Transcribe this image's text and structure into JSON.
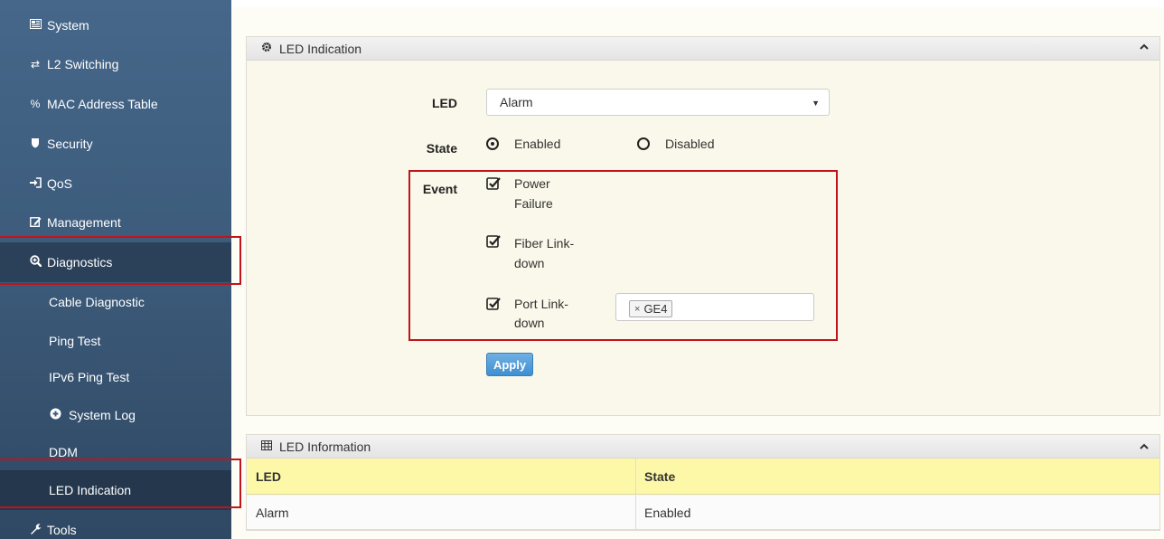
{
  "sidebar": {
    "items": [
      {
        "label": "System",
        "icon": "system-icon"
      },
      {
        "label": "L2 Switching",
        "icon": "switch-arrows-icon"
      },
      {
        "label": "MAC Address Table",
        "icon": "link-icon"
      },
      {
        "label": "Security",
        "icon": "shield-icon"
      },
      {
        "label": "QoS",
        "icon": "sign-in-icon"
      },
      {
        "label": "Management",
        "icon": "edit-icon"
      },
      {
        "label": "Diagnostics",
        "icon": "search-plus-icon"
      },
      {
        "label": "Cable Diagnostic"
      },
      {
        "label": "Ping Test"
      },
      {
        "label": "IPv6 Ping Test"
      },
      {
        "label": "System Log",
        "icon": "plus-circle-icon"
      },
      {
        "label": "DDM"
      },
      {
        "label": "LED Indication"
      },
      {
        "label": "Tools",
        "icon": "wrench-icon"
      }
    ]
  },
  "led_panel": {
    "title": "LED Indication",
    "led_label": "LED",
    "led_value": "Alarm",
    "state_label": "State",
    "state_enabled": "Enabled",
    "state_disabled": "Disabled",
    "event_label": "Event",
    "events": [
      {
        "line1": "Power",
        "line2": "Failure",
        "checked": true
      },
      {
        "line1": "Fiber Link-",
        "line2": "down",
        "checked": true
      },
      {
        "line1": "Port Link-",
        "line2": "down",
        "checked": true
      }
    ],
    "port_tag": "GE4",
    "apply_label": "Apply"
  },
  "info_panel": {
    "title": "LED Information",
    "columns": [
      "LED",
      "State"
    ],
    "rows": [
      [
        "Alarm",
        "Enabled"
      ]
    ]
  },
  "colors": {
    "sidebar": "#3d5c7c",
    "highlight_box": "#c0141c",
    "table_header": "#fdf8a8",
    "apply_button": "#428bca"
  }
}
